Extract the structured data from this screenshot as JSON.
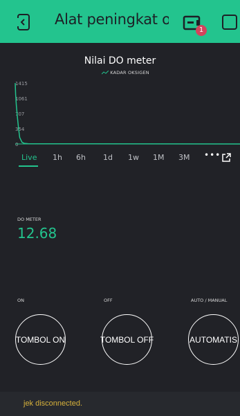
{
  "header": {
    "title": "Alat peningkat oksigen",
    "notification_count": "1",
    "left_icon": "device-back-icon",
    "device_icon": "device-board-icon",
    "right_icon": "square-icon",
    "accent": "#23c48e"
  },
  "chart": {
    "title": "Nilai DO meter",
    "legend": "KADAR OKSIGEN",
    "ranges": [
      "Live",
      "1h",
      "6h",
      "1d",
      "1w",
      "1M",
      "3M"
    ],
    "active_range": "Live",
    "more_label": "•••",
    "expand_icon": "expand-icon"
  },
  "chart_data": {
    "type": "line",
    "title": "Nilai DO meter",
    "series": [
      {
        "name": "KADAR OKSIGEN",
        "x": [
          0,
          0.2,
          0.5,
          1,
          1.5,
          2,
          3,
          4,
          5,
          6,
          100
        ],
        "values": [
          1415,
          1150,
          900,
          600,
          350,
          150,
          40,
          15,
          10,
          5,
          0
        ]
      }
    ],
    "yticks": [
      "1415",
      "1061",
      "707",
      "354",
      "0"
    ],
    "ylim": [
      0,
      1415
    ],
    "grid": false,
    "color": "#23c48e"
  },
  "do_meter": {
    "label": "DO METER",
    "value": "12.68"
  },
  "buttons": [
    {
      "label": "ON",
      "text": "TOMBOL ON"
    },
    {
      "label": "OFF",
      "text": "TOMBOL OFF"
    },
    {
      "label": "AUTO / MANUAL",
      "text": "AUTOMATIS"
    }
  ],
  "footer": {
    "status": "jek disconnected.",
    "status_color": "#d8b23b"
  }
}
